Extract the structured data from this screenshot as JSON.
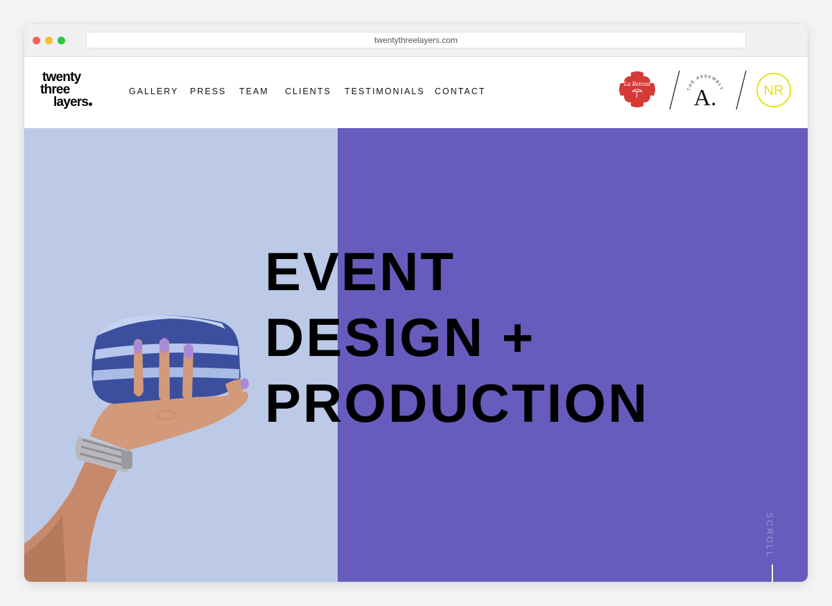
{
  "browser": {
    "url": "twentythreelayers.com",
    "controls": [
      "close",
      "minimize",
      "maximize"
    ]
  },
  "site": {
    "logo": {
      "line1": "twenty",
      "line2": "three",
      "line3": "layers"
    },
    "nav": [
      {
        "label": "GALLERY"
      },
      {
        "label": "PRESS"
      },
      {
        "label": "TEAM"
      },
      {
        "label": "CLIENTS"
      },
      {
        "label": "TESTIMONIALS"
      },
      {
        "label": "CONTACT"
      }
    ],
    "brands": {
      "retreat": {
        "text": "La Retreat",
        "color": "#d63a37"
      },
      "assembly": {
        "arc_text": "THE ASSEMBLY",
        "letter": "A."
      },
      "nr": {
        "text": "NR",
        "color": "#e3e21a"
      }
    }
  },
  "hero": {
    "headline": [
      "EVENT",
      "DESIGN +",
      "PRODUCTION"
    ],
    "scroll_label": "SCROLL",
    "colors": {
      "left_panel": "#bccae8",
      "right_panel": "#675cbd"
    },
    "image_icon": "hand-holding-blue-cake"
  }
}
